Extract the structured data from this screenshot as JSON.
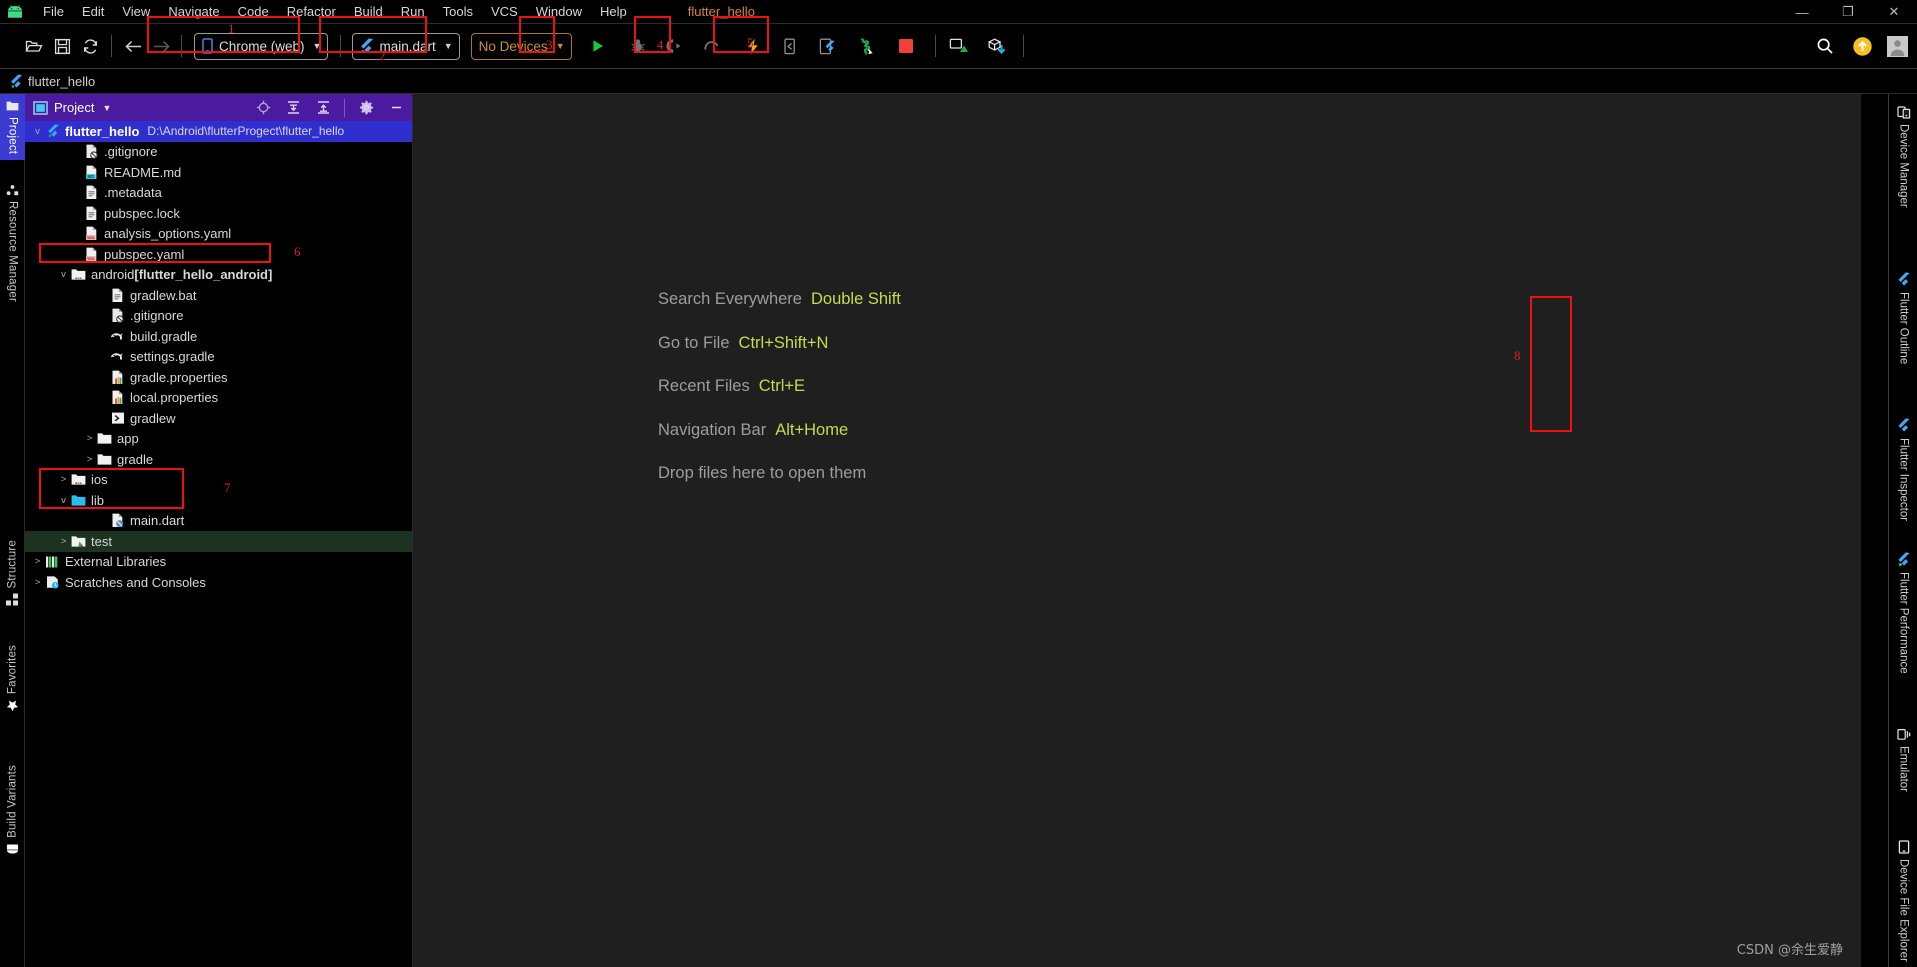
{
  "window": {
    "title": "flutter_hello",
    "minimize_label": "—",
    "maximize_label": "❐",
    "close_label": "✕"
  },
  "menubar": {
    "logo_icon": "android-logo-icon",
    "items": [
      {
        "label": "File"
      },
      {
        "label": "Edit"
      },
      {
        "label": "View"
      },
      {
        "label": "Navigate"
      },
      {
        "label": "Code"
      },
      {
        "label": "Refactor"
      },
      {
        "label": "Build"
      },
      {
        "label": "Run"
      },
      {
        "label": "Tools"
      },
      {
        "label": "VCS"
      },
      {
        "label": "Window"
      },
      {
        "label": "Help"
      }
    ]
  },
  "toolbar": {
    "open_icon": "open-folder-icon",
    "save_icon": "save-icon",
    "sync_icon": "sync-icon",
    "back_icon": "arrow-back-icon",
    "forward_icon": "arrow-forward-icon",
    "device_selector": {
      "label": "Chrome (web)",
      "icon": "phone-icon",
      "caret": "▼"
    },
    "run_config_selector": {
      "label": "main.dart",
      "icon": "flutter-icon",
      "caret": "▼"
    },
    "avd_selector": {
      "label": "No Devices",
      "caret": "▼"
    },
    "run_icon": "run-play-icon",
    "debug_icon": "debug-bug-icon",
    "profile_icon": "profile-icon",
    "coverage_icon": "coverage-icon",
    "hot_reload_icon": "hot-reload-lightning-icon",
    "hot_restart_icon": "hot-restart-icon",
    "open_devtools_icon": "flutter-devtools-icon",
    "stop_icon": "stop-square-icon",
    "avd_manager_icon": "avd-manager-icon",
    "sdk_manager_icon": "sdk-manager-icon",
    "search_icon": "search-icon",
    "update_badge_icon": "update-arrow-badge-icon",
    "avatar_icon": "user-avatar-icon"
  },
  "annotations": [
    {
      "num": "1",
      "target": "device-selector"
    },
    {
      "num": "2",
      "target": "run-config-selector"
    },
    {
      "num": "3",
      "target": "run-button"
    },
    {
      "num": "4",
      "target": "hot-reload-button"
    },
    {
      "num": "5",
      "target": "stop-button"
    },
    {
      "num": "6",
      "target": "android-module-row"
    },
    {
      "num": "7",
      "target": "lib-folder-group"
    },
    {
      "num": "8",
      "target": "flutter-inspector-tab"
    }
  ],
  "navbar": {
    "icon": "flutter-icon",
    "crumb": "flutter_hello"
  },
  "left_tabs": [
    {
      "label": "Project",
      "icon": "project-folder-icon",
      "active": true
    },
    {
      "label": "Resource Manager",
      "icon": "resource-manager-icon",
      "active": false
    },
    {
      "label": "Structure",
      "icon": "structure-icon",
      "active": false
    },
    {
      "label": "Favorites",
      "icon": "star-icon",
      "active": false
    },
    {
      "label": "Build Variants",
      "icon": "build-variants-icon",
      "active": false
    }
  ],
  "right_tabs": [
    {
      "label": "Device Manager",
      "icon": "device-manager-icon"
    },
    {
      "label": "Flutter Outline",
      "icon": "flutter-icon"
    },
    {
      "label": "Flutter Inspector",
      "icon": "flutter-icon"
    },
    {
      "label": "Flutter Performance",
      "icon": "flutter-perf-icon"
    },
    {
      "label": "Emulator",
      "icon": "emulator-icon"
    },
    {
      "label": "Device File Explorer",
      "icon": "device-file-explorer-icon"
    }
  ],
  "project_panel": {
    "header": {
      "title": "Project",
      "view_icon": "project-view-icon",
      "caret": "▼",
      "locate_icon": "locate-target-icon",
      "expand_icon": "expand-all-icon",
      "collapse_icon": "collapse-all-icon",
      "settings_icon": "gear-icon",
      "hide_icon": "minimize-panel-icon"
    },
    "tree": [
      {
        "depth": 0,
        "arrow": "v",
        "icon": "flutter-icon",
        "label": "flutter_hello",
        "bold": true,
        "path": "D:\\Android\\flutterProgect\\flutter_hello",
        "selected": true
      },
      {
        "depth": 2,
        "arrow": "",
        "icon": "gitignore-icon",
        "label": ".gitignore"
      },
      {
        "depth": 2,
        "arrow": "",
        "icon": "markdown-icon",
        "label": "README.md"
      },
      {
        "depth": 2,
        "arrow": "",
        "icon": "file-icon",
        "label": ".metadata"
      },
      {
        "depth": 2,
        "arrow": "",
        "icon": "file-icon",
        "label": "pubspec.lock"
      },
      {
        "depth": 2,
        "arrow": "",
        "icon": "yaml-icon",
        "label": "analysis_options.yaml"
      },
      {
        "depth": 2,
        "arrow": "",
        "icon": "yaml-icon",
        "label": "pubspec.yaml"
      },
      {
        "depth": 1,
        "arrow": "v",
        "icon": "module-folder-icon",
        "label": "android ",
        "suffix": "[flutter_hello_android]"
      },
      {
        "depth": 3,
        "arrow": "",
        "icon": "file-icon",
        "label": "gradlew.bat"
      },
      {
        "depth": 3,
        "arrow": "",
        "icon": "gitignore-icon",
        "label": ".gitignore"
      },
      {
        "depth": 3,
        "arrow": "",
        "icon": "gradle-icon",
        "label": "build.gradle"
      },
      {
        "depth": 3,
        "arrow": "",
        "icon": "gradle-icon",
        "label": "settings.gradle"
      },
      {
        "depth": 3,
        "arrow": "",
        "icon": "properties-icon",
        "label": "gradle.properties"
      },
      {
        "depth": 3,
        "arrow": "",
        "icon": "properties-icon",
        "label": "local.properties"
      },
      {
        "depth": 3,
        "arrow": "",
        "icon": "script-icon",
        "label": "gradlew"
      },
      {
        "depth": 2,
        "arrow": ">",
        "icon": "folder-icon",
        "label": "app"
      },
      {
        "depth": 2,
        "arrow": ">",
        "icon": "folder-icon",
        "label": "gradle"
      },
      {
        "depth": 1,
        "arrow": ">",
        "icon": "module-folder-icon",
        "label": "ios"
      },
      {
        "depth": 1,
        "arrow": "v",
        "icon": "source-folder-icon",
        "label": "lib"
      },
      {
        "depth": 3,
        "arrow": "",
        "icon": "dart-icon",
        "label": "main.dart"
      },
      {
        "depth": 1,
        "arrow": ">",
        "icon": "test-folder-icon",
        "label": "test",
        "green": true
      },
      {
        "depth": 0,
        "arrow": ">",
        "icon": "external-libraries-icon",
        "label": "External Libraries"
      },
      {
        "depth": 0,
        "arrow": ">",
        "icon": "scratches-icon",
        "label": "Scratches and Consoles"
      }
    ]
  },
  "editor": {
    "hints": [
      {
        "action": "Search Everywhere",
        "key": "Double Shift"
      },
      {
        "action": "Go to File",
        "key": "Ctrl+Shift+N"
      },
      {
        "action": "Recent Files",
        "key": "Ctrl+E"
      },
      {
        "action": "Navigation Bar",
        "key": "Alt+Home"
      },
      {
        "action": "Drop files here to open them",
        "key": ""
      }
    ],
    "watermark": "CSDN @余生爱静"
  },
  "colors": {
    "accent_purple": "#4b1a9e",
    "selection_blue": "#2f2fd0",
    "annotation_red": "#ee1111",
    "hint_key_yellow": "#c9d94b",
    "orange_combo": "#c8922f",
    "title_orange": "#d4863a",
    "editor_bg": "#1f1f1f"
  }
}
